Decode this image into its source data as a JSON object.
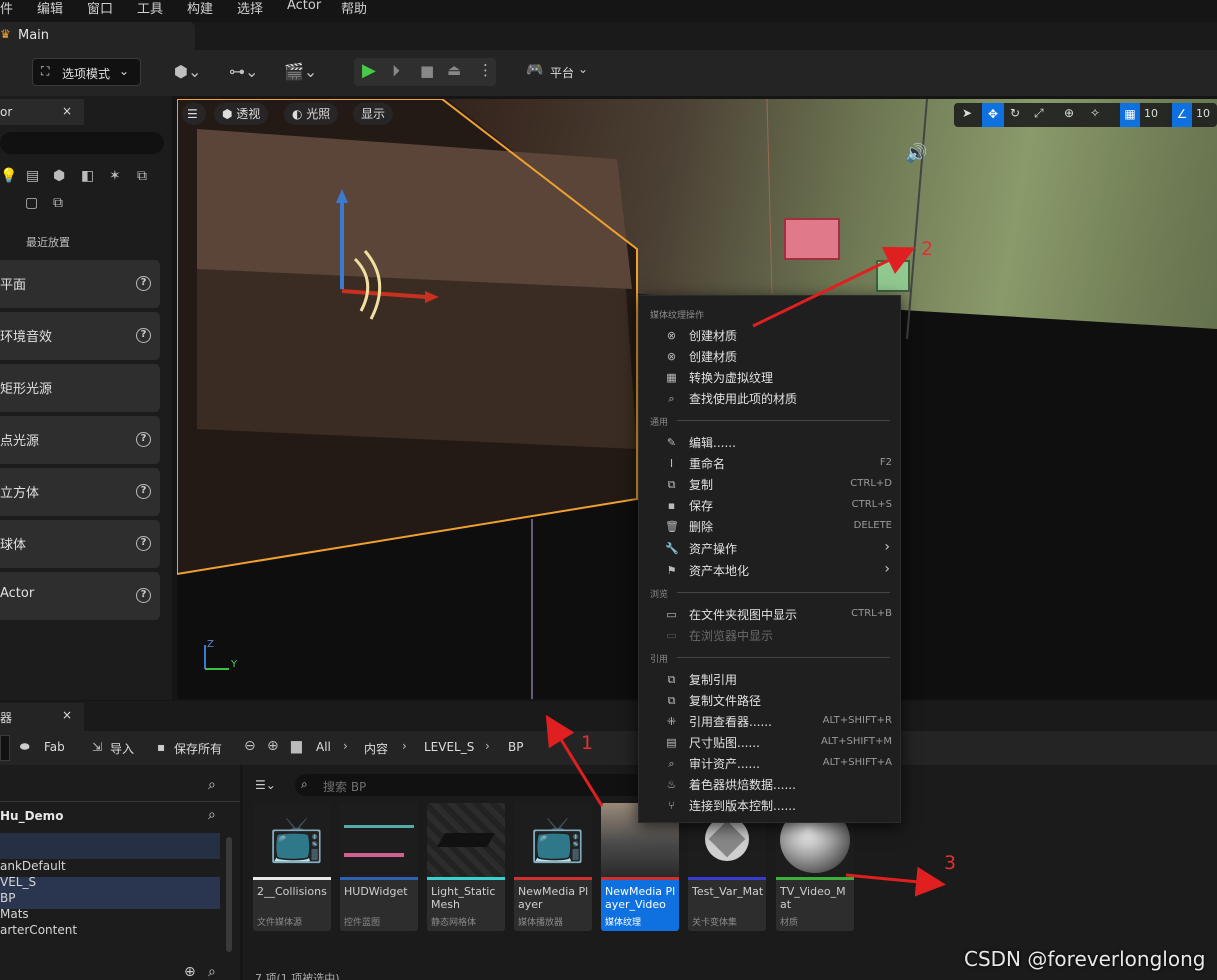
{
  "menu": [
    "件",
    "编辑",
    "窗口",
    "工具",
    "构建",
    "选择",
    "Actor",
    "帮助"
  ],
  "tab": {
    "title": "Main"
  },
  "toolbar": {
    "mode": "选项模式",
    "platform": "平台"
  },
  "place_panel": {
    "tab_label": "or",
    "recent": "最近放置",
    "items": [
      "平面",
      "环境音效",
      "矩形光源",
      "点光源",
      "立方体",
      "球体",
      "Actor"
    ]
  },
  "viewport": {
    "perspective": "透视",
    "lighting": "光照",
    "show": "显示",
    "grid_snap": "10",
    "rot_snap": "10",
    "axis_y": "Y",
    "axis_z": "Z"
  },
  "context_menu": {
    "sections": [
      "媒体纹理操作",
      "通用",
      "浏览",
      "引用"
    ],
    "media_items": [
      {
        "icon": "material-icon",
        "glyph": "⊗",
        "label": "创建材质"
      },
      {
        "icon": "material-icon",
        "glyph": "⊗",
        "label": "创建材质"
      },
      {
        "icon": "virtual-texture-icon",
        "glyph": "▦",
        "label": "转换为虚拟纹理"
      },
      {
        "icon": "search-icon",
        "glyph": "⌕",
        "label": "查找使用此项的材质"
      }
    ],
    "common_items": [
      {
        "icon": "edit-icon",
        "glyph": "✎",
        "label": "编辑......",
        "shortcut": ""
      },
      {
        "icon": "rename-icon",
        "glyph": "Ⅰ",
        "label": "重命名",
        "shortcut": "F2"
      },
      {
        "icon": "duplicate-icon",
        "glyph": "⧉",
        "label": "复制",
        "shortcut": "CTRL+D"
      },
      {
        "icon": "save-icon",
        "glyph": "▪",
        "label": "保存",
        "shortcut": "CTRL+S"
      },
      {
        "icon": "delete-icon",
        "glyph": "🗑",
        "label": "删除",
        "shortcut": "DELETE"
      },
      {
        "icon": "wrench-icon",
        "glyph": "🔧",
        "label": "资产操作",
        "shortcut": "",
        "submenu": true
      },
      {
        "icon": "flag-icon",
        "glyph": "⚑",
        "label": "资产本地化",
        "shortcut": "",
        "submenu": true
      }
    ],
    "browse_items": [
      {
        "icon": "folder-icon",
        "glyph": "▭",
        "label": "在文件夹视图中显示",
        "shortcut": "CTRL+B",
        "disabled": false
      },
      {
        "icon": "browser-icon",
        "glyph": "▭",
        "label": "在浏览器中显示",
        "shortcut": "",
        "disabled": true
      }
    ],
    "ref_items": [
      {
        "icon": "copy-ref-icon",
        "glyph": "⧉",
        "label": "复制引用",
        "shortcut": ""
      },
      {
        "icon": "copy-path-icon",
        "glyph": "⧉",
        "label": "复制文件路径",
        "shortcut": ""
      },
      {
        "icon": "ref-viewer-icon",
        "glyph": "⁜",
        "label": "引用查看器......",
        "shortcut": "ALT+SHIFT+R"
      },
      {
        "icon": "size-map-icon",
        "glyph": "▤",
        "label": "尺寸贴图......",
        "shortcut": "ALT+SHIFT+M"
      },
      {
        "icon": "audit-icon",
        "glyph": "⌕",
        "label": "审计资产......",
        "shortcut": "ALT+SHIFT+A"
      },
      {
        "icon": "shader-icon",
        "glyph": "♨",
        "label": "着色器烘焙数据......",
        "shortcut": ""
      },
      {
        "icon": "source-control-icon",
        "glyph": "⑂",
        "label": "连接到版本控制......",
        "shortcut": ""
      }
    ]
  },
  "content_browser": {
    "tab_label": "器",
    "fab": "Fab",
    "import": "导入",
    "save_all": "保存所有",
    "path": [
      "All",
      "内容",
      "LEVEL_S",
      "BP"
    ],
    "search_placeholder": "搜索 BP",
    "project": "Hu_Demo",
    "tree": [
      "ankDefault",
      "VEL_S",
      "BP",
      "Mats",
      "arterContent"
    ],
    "status": "7 项(1 项被选中)",
    "assets": [
      {
        "name": "2__Collisions",
        "type": "文件媒体源",
        "color": "#e8e8e8"
      },
      {
        "name": "HUDWidget",
        "type": "控件蓝图",
        "color": "#2f5fb0"
      },
      {
        "name": "Light_Static Mesh",
        "type": "静态网格体",
        "color": "#3ad0d0"
      },
      {
        "name": "NewMedia Player",
        "type": "媒体播放器",
        "color": "#d03030"
      },
      {
        "name": "NewMedia Player_Video",
        "type": "媒体纹理",
        "color": "#d03030"
      },
      {
        "name": "Test_Var_Mat",
        "type": "关卡变体集",
        "color": "#3a3ad0"
      },
      {
        "name": "TV_Video_Mat",
        "type": "材质",
        "color": "#3ab03a"
      }
    ]
  },
  "annotations": [
    "1",
    "2",
    "3"
  ],
  "watermark": "CSDN @foreverlonglong"
}
